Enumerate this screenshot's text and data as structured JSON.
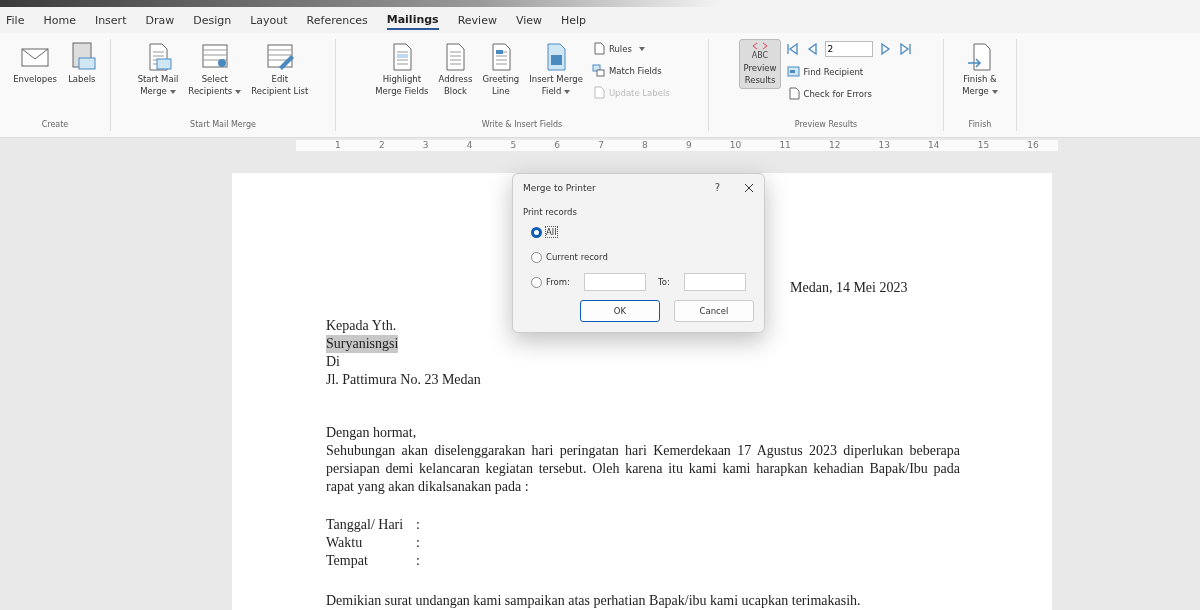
{
  "top_menu": [
    {
      "label": "File",
      "selected": false
    },
    {
      "label": "Home",
      "selected": false
    },
    {
      "label": "Insert",
      "selected": false
    },
    {
      "label": "Draw",
      "selected": false
    },
    {
      "label": "Design",
      "selected": false
    },
    {
      "label": "Layout",
      "selected": false
    },
    {
      "label": "References",
      "selected": false
    },
    {
      "label": "Mailings",
      "selected": true
    },
    {
      "label": "Review",
      "selected": false
    },
    {
      "label": "View",
      "selected": false
    },
    {
      "label": "Help",
      "selected": false
    }
  ],
  "ribbon": {
    "groups": [
      {
        "label": "Create",
        "items": [
          {
            "kind": "large",
            "lines": [
              "Envelopes"
            ],
            "dropdown": false
          },
          {
            "kind": "large",
            "lines": [
              "Labels"
            ],
            "dropdown": false
          }
        ]
      },
      {
        "label": "Start Mail Merge",
        "items": [
          {
            "kind": "large",
            "lines": [
              "Start Mail",
              "Merge"
            ],
            "dropdown": true
          },
          {
            "kind": "large",
            "lines": [
              "Select",
              "Recipients"
            ],
            "dropdown": true
          },
          {
            "kind": "large",
            "lines": [
              "Edit",
              "Recipient List"
            ],
            "dropdown": false
          }
        ]
      },
      {
        "label": "Write & Insert Fields",
        "items": [
          {
            "kind": "large",
            "lines": [
              "Highlight",
              "Merge Fields"
            ],
            "dropdown": false
          },
          {
            "kind": "large",
            "lines": [
              "Address",
              "Block"
            ],
            "dropdown": false
          },
          {
            "kind": "large",
            "lines": [
              "Greeting",
              "Line"
            ],
            "dropdown": false
          },
          {
            "kind": "large",
            "lines": [
              "Insert Merge",
              "Field"
            ],
            "dropdown": true
          },
          {
            "kind": "stack",
            "buttons": [
              {
                "label": "Rules",
                "dropdown": true,
                "disabled": false
              },
              {
                "label": "Match Fields",
                "dropdown": false,
                "disabled": false
              },
              {
                "label": "Update Labels",
                "dropdown": false,
                "disabled": true
              }
            ]
          }
        ]
      },
      {
        "label": "Preview Results",
        "items": [
          {
            "kind": "toggle",
            "icon_text": "ABC",
            "lines": [
              "Preview",
              "Results"
            ],
            "selected": true
          },
          {
            "kind": "nav",
            "record": "2",
            "buttons": [
              {
                "label": "Find Recipient",
                "dropdown": false,
                "disabled": false
              },
              {
                "label": "Check for Errors",
                "dropdown": false,
                "disabled": false
              }
            ]
          }
        ]
      },
      {
        "label": "Finish",
        "items": [
          {
            "kind": "large",
            "lines": [
              "Finish &",
              "Merge"
            ],
            "dropdown": true
          }
        ]
      }
    ]
  },
  "ruler": {
    "numbers": [
      "1",
      "2",
      "3",
      "4",
      "5",
      "6",
      "7",
      "8",
      "9",
      "10",
      "11",
      "12",
      "13",
      "14",
      "15",
      "16"
    ]
  },
  "document": {
    "date": "Medan, 14 Mei 2023",
    "address": [
      {
        "text": "Kepada Yth.",
        "highlighted": false
      },
      {
        "text": "Suryanisngsi",
        "highlighted": true
      },
      {
        "text": "Di",
        "highlighted": false
      },
      {
        "text": "Jl. Pattimura No. 23 Medan",
        "highlighted": false
      }
    ],
    "greeting": "Dengan hormat,",
    "body": "Sehubungan akan diselenggarakan hari peringatan hari Kemerdekaan 17 Agustus 2023 diperlukan beberapa persiapan demi kelancaran kegiatan tersebut. Oleh karena itu kami kami harapkan kehadian Bapak/Ibu pada rapat yang akan dikalsanakan pada :",
    "details": [
      {
        "label": "Tanggal/ Hari",
        "separator": ":"
      },
      {
        "label": "Waktu",
        "separator": ":"
      },
      {
        "label": "Tempat",
        "separator": ":"
      }
    ],
    "closing": "Demikian surat undangan kami sampaikan atas perhatian Bapak/ibu kami ucapkan terimakasih."
  },
  "dialog": {
    "title": "Merge to Printer",
    "help": "?",
    "group_label": "Print records",
    "options": [
      {
        "kind": "plain",
        "label": "All",
        "selected": true
      },
      {
        "kind": "plain",
        "label": "Current record",
        "selected": false
      },
      {
        "kind": "range",
        "label": "From:",
        "to_label": "To:",
        "selected": false
      }
    ],
    "buttons": [
      {
        "label": "OK",
        "default": true
      },
      {
        "label": "Cancel",
        "default": false
      }
    ]
  }
}
